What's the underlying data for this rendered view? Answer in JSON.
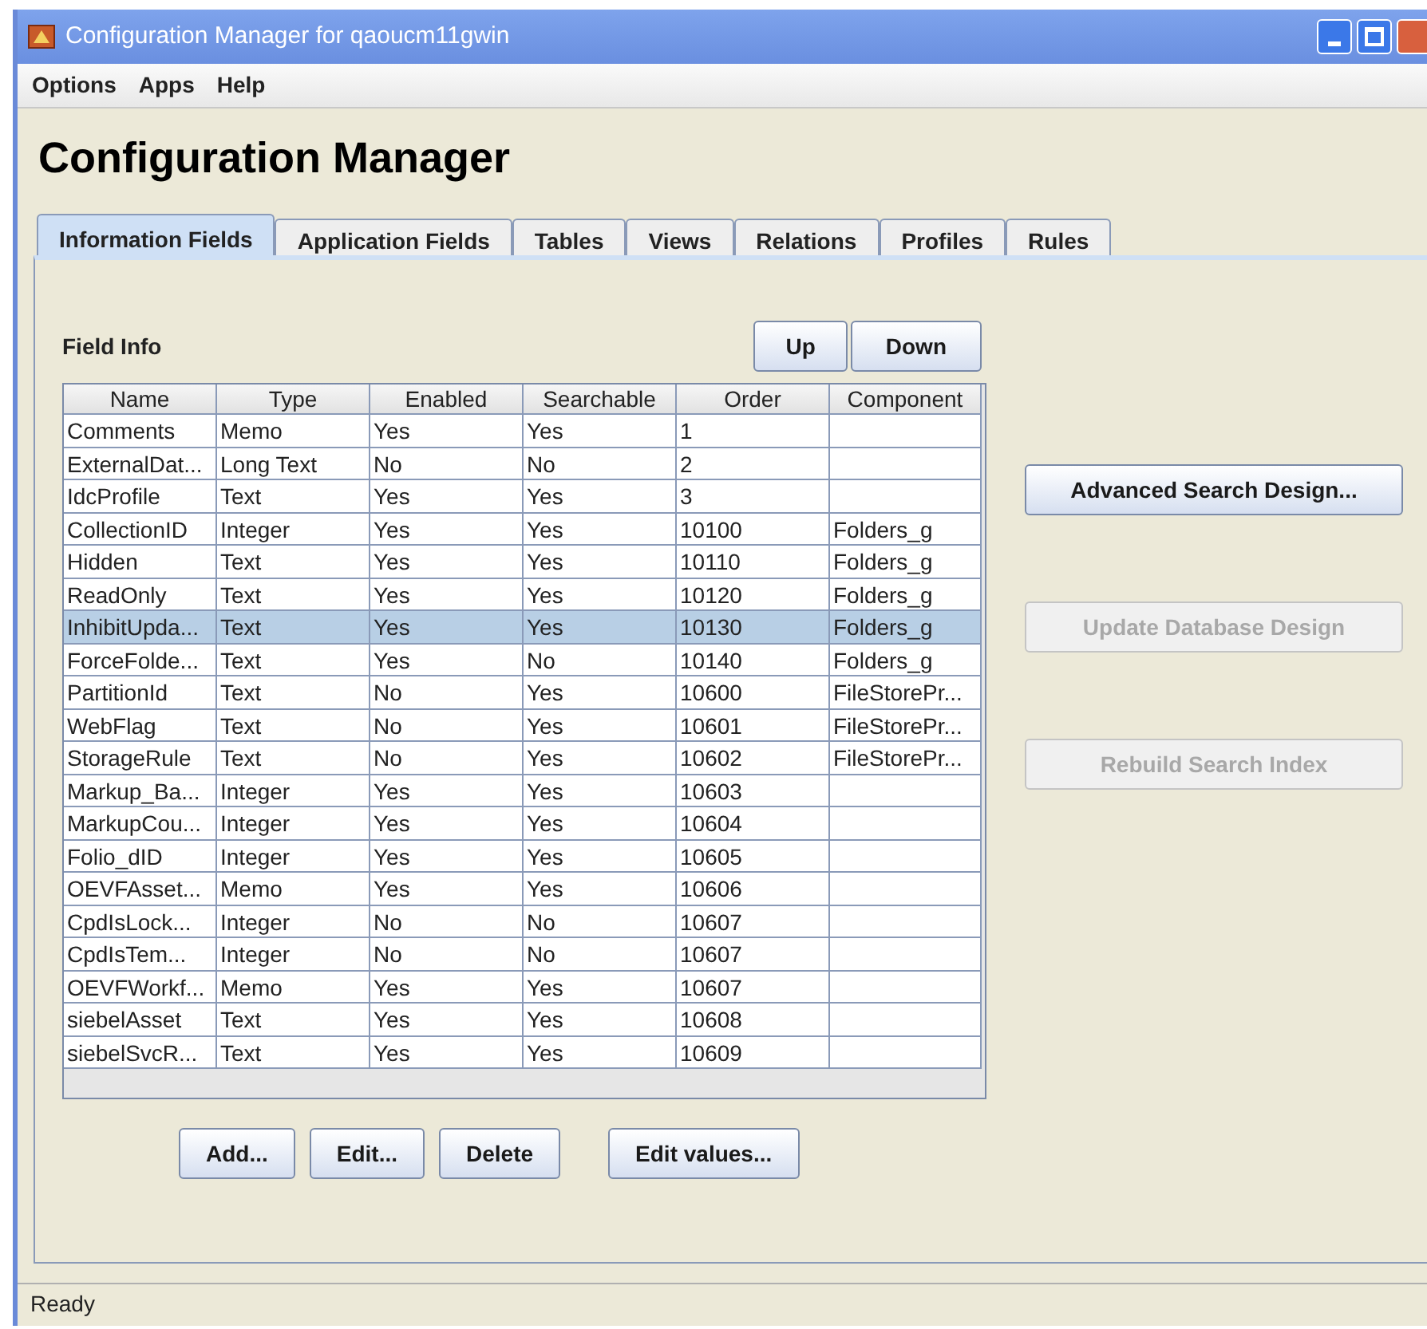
{
  "window": {
    "title": "Configuration Manager for qaoucm11gwin"
  },
  "menu": [
    "Options",
    "Apps",
    "Help"
  ],
  "heading": "Configuration Manager",
  "tabs": [
    {
      "label": "Information Fields",
      "selected": true
    },
    {
      "label": "Application Fields",
      "selected": false
    },
    {
      "label": "Tables",
      "selected": false
    },
    {
      "label": "Views",
      "selected": false
    },
    {
      "label": "Relations",
      "selected": false
    },
    {
      "label": "Profiles",
      "selected": false
    },
    {
      "label": "Rules",
      "selected": false
    }
  ],
  "field_info": {
    "label": "Field Info",
    "move_buttons": [
      "Up",
      "Down"
    ]
  },
  "table": {
    "columns": [
      "Name",
      "Type",
      "Enabled",
      "Searchable",
      "Order",
      "Component"
    ],
    "rows": [
      {
        "cells": [
          "Comments",
          "Memo",
          "Yes",
          "Yes",
          "1",
          ""
        ],
        "selected": false
      },
      {
        "cells": [
          "ExternalDat...",
          "Long Text",
          "No",
          "No",
          "2",
          ""
        ],
        "selected": false
      },
      {
        "cells": [
          "IdcProfile",
          "Text",
          "Yes",
          "Yes",
          "3",
          ""
        ],
        "selected": false
      },
      {
        "cells": [
          "CollectionID",
          "Integer",
          "Yes",
          "Yes",
          "10100",
          "Folders_g"
        ],
        "selected": false
      },
      {
        "cells": [
          "Hidden",
          "Text",
          "Yes",
          "Yes",
          "10110",
          "Folders_g"
        ],
        "selected": false
      },
      {
        "cells": [
          "ReadOnly",
          "Text",
          "Yes",
          "Yes",
          "10120",
          "Folders_g"
        ],
        "selected": false
      },
      {
        "cells": [
          "InhibitUpda...",
          "Text",
          "Yes",
          "Yes",
          "10130",
          "Folders_g"
        ],
        "selected": true
      },
      {
        "cells": [
          "ForceFolde...",
          "Text",
          "Yes",
          "No",
          "10140",
          "Folders_g"
        ],
        "selected": false
      },
      {
        "cells": [
          "PartitionId",
          "Text",
          "No",
          "Yes",
          "10600",
          "FileStorePr..."
        ],
        "selected": false
      },
      {
        "cells": [
          "WebFlag",
          "Text",
          "No",
          "Yes",
          "10601",
          "FileStorePr..."
        ],
        "selected": false
      },
      {
        "cells": [
          "StorageRule",
          "Text",
          "No",
          "Yes",
          "10602",
          "FileStorePr..."
        ],
        "selected": false
      },
      {
        "cells": [
          "Markup_Ba...",
          "Integer",
          "Yes",
          "Yes",
          "10603",
          ""
        ],
        "selected": false
      },
      {
        "cells": [
          "MarkupCou...",
          "Integer",
          "Yes",
          "Yes",
          "10604",
          ""
        ],
        "selected": false
      },
      {
        "cells": [
          "Folio_dID",
          "Integer",
          "Yes",
          "Yes",
          "10605",
          ""
        ],
        "selected": false
      },
      {
        "cells": [
          "OEVFAsset...",
          "Memo",
          "Yes",
          "Yes",
          "10606",
          ""
        ],
        "selected": false
      },
      {
        "cells": [
          "CpdIsLock...",
          "Integer",
          "No",
          "No",
          "10607",
          ""
        ],
        "selected": false
      },
      {
        "cells": [
          "CpdIsTem...",
          "Integer",
          "No",
          "No",
          "10607",
          ""
        ],
        "selected": false
      },
      {
        "cells": [
          "OEVFWorkf...",
          "Memo",
          "Yes",
          "Yes",
          "10607",
          ""
        ],
        "selected": false
      },
      {
        "cells": [
          "siebelAsset",
          "Text",
          "Yes",
          "Yes",
          "10608",
          ""
        ],
        "selected": false
      },
      {
        "cells": [
          "siebelSvcR...",
          "Text",
          "Yes",
          "Yes",
          "10609",
          ""
        ],
        "selected": false
      }
    ]
  },
  "bottom_buttons": [
    "Add...",
    "Edit...",
    "Delete",
    "Edit values..."
  ],
  "side_buttons": [
    {
      "label": "Advanced Search Design...",
      "disabled": false
    },
    {
      "label": "Update Database Design",
      "disabled": true
    },
    {
      "label": "Rebuild Search Index",
      "disabled": true
    }
  ],
  "status_bar": "Ready"
}
